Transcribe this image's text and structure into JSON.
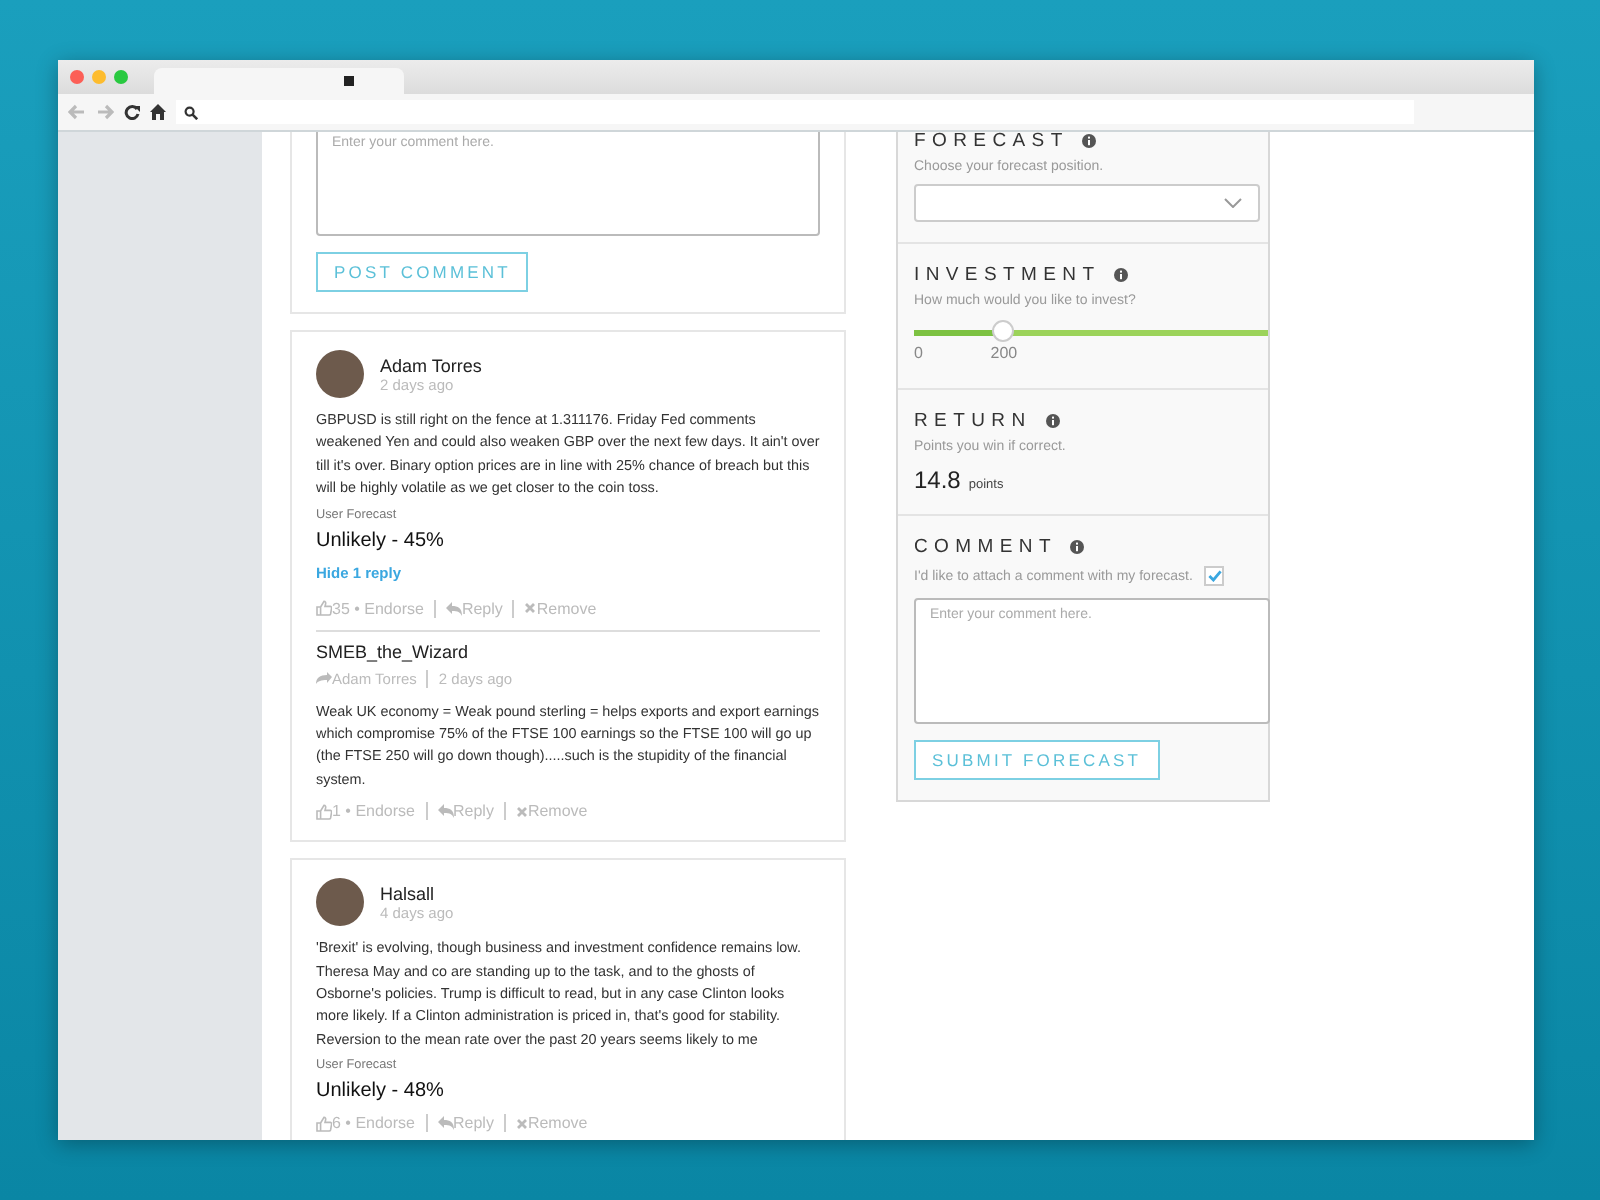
{
  "post_form": {
    "placeholder": "Enter your comment here.",
    "button": "POST COMMENT"
  },
  "comments": [
    {
      "author": "Adam Torres",
      "time": "2 days ago",
      "text": "GBPUSD is still right on the fence at 1.311176. Friday Fed comments weakened Yen and could also weaken GBP over the next few days. It ain't over till it's over. Binary option prices are in line with 25% chance of breach but this will be highly volatile as we get closer to the coin toss.",
      "forecast_label": "User Forecast",
      "forecast": "Unlikely - 45%",
      "toggle": "Hide 1 reply",
      "count": "35",
      "endorse": "• Endorse",
      "reply": "Reply",
      "remove": "Remove",
      "replies": [
        {
          "author": "SMEB_the_Wizard",
          "reply_to": "Adam Torres",
          "time": "2 days ago",
          "text": "Weak UK economy = Weak pound sterling = helps exports and export earnings which compromise 75% of the FTSE 100 earnings so the FTSE 100 will go up (the FTSE 250 will go down though).....such is the stupidity of the financial system.",
          "count": "1",
          "endorse": "• Endorse",
          "reply": "Reply",
          "remove": "Remove"
        }
      ]
    },
    {
      "author": "Halsall",
      "time": "4 days ago",
      "text": "'Brexit' is evolving, though business and investment confidence remains low. Theresa May and co are standing up to the task, and to the ghosts of Osborne's policies. Trump is difficult to read, but in any case Clinton looks more likely. If a Clinton administration is priced in, that's good for stability. Reversion to the mean rate over the past 20 years seems likely to me",
      "forecast_label": "User Forecast",
      "forecast": "Unlikely - 48%",
      "count": "6",
      "endorse": "• Endorse",
      "reply": "Reply",
      "remove": "Remove"
    }
  ],
  "forecast_panel": {
    "forecast": {
      "title": "FORECAST",
      "hint": "Choose your forecast position."
    },
    "investment": {
      "title": "INVESTMENT",
      "hint": "How much would you like to invest?",
      "level": 0.25,
      "min": "0",
      "value": "200"
    },
    "return": {
      "title": "RETURN",
      "hint": "Points you win if correct.",
      "value": "14.8",
      "unit": "points"
    },
    "comment": {
      "title": "COMMENT",
      "attach_label": "I'd like to attach a comment with my forecast.",
      "checked": true,
      "placeholder": "Enter your comment here.",
      "button": "SUBMIT FORECAST"
    }
  }
}
